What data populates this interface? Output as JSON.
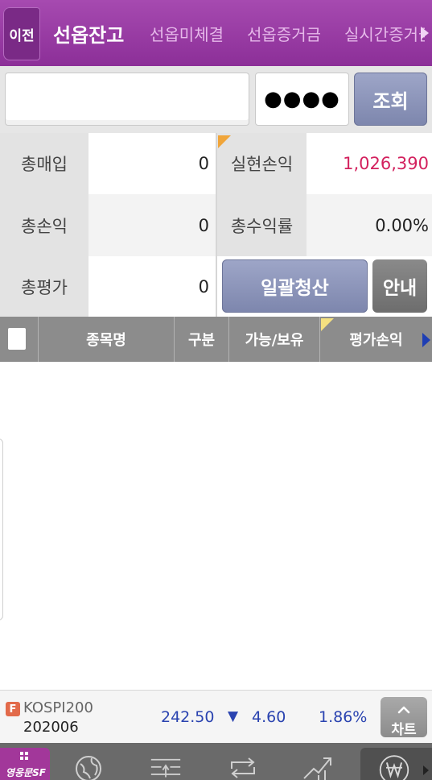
{
  "header": {
    "back_label": "이전",
    "tabs": [
      {
        "label": "선옵잔고",
        "active": true
      },
      {
        "label": "선옵미체결",
        "active": false
      },
      {
        "label": "선옵증거금",
        "active": false
      },
      {
        "label": "실시간증거금",
        "active": false
      }
    ]
  },
  "search": {
    "account_value": "",
    "password_mask": "●●●●",
    "query_label": "조회"
  },
  "summary": {
    "total_purchase_label": "총매입",
    "total_purchase_value": "0",
    "realized_pl_label": "실현손익",
    "realized_pl_value": "1,026,390",
    "total_pl_label": "총손익",
    "total_pl_value": "0",
    "total_return_label": "총수익률",
    "total_return_value": "0.00%",
    "total_eval_label": "총평가",
    "total_eval_value": "0",
    "liquidate_label": "일괄청산",
    "guide_label": "안내"
  },
  "table": {
    "columns": [
      "종목명",
      "구분",
      "가능/보유",
      "평가손익"
    ],
    "rows": []
  },
  "ticker": {
    "badge": "F",
    "name": "KOSPI200",
    "code": "202006",
    "price": "242.50",
    "direction_symbol": "▼",
    "change": "4.60",
    "rate": "1.86%",
    "chart_label": "차트"
  },
  "bottom_nav": {
    "brand_label": "영웅문SF",
    "items": [
      "globe-icon",
      "order-icon",
      "transfer-icon",
      "trend-icon",
      "won-icon"
    ]
  },
  "colors": {
    "header_purple": "#9a3ca6",
    "realized_pl_red": "#d3215e",
    "ticker_blue": "#2a43b0",
    "button_slate": "#8d95bb"
  }
}
